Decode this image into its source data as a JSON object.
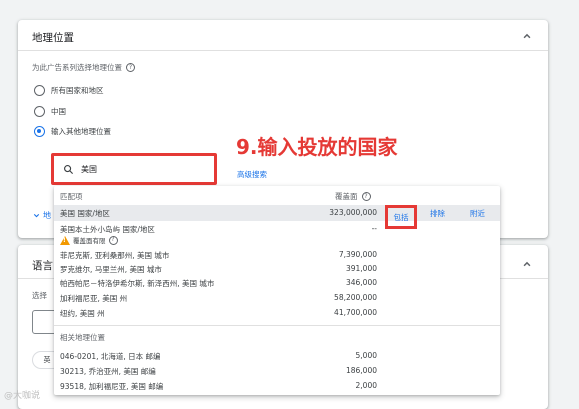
{
  "geo_card": {
    "title": "地理位置",
    "prompt": "为此广告系列选择地理位置",
    "options": [
      {
        "label": "所有国家和地区",
        "selected": false
      },
      {
        "label": "中国",
        "selected": false
      },
      {
        "label": "输入其他地理位置",
        "selected": true
      }
    ],
    "search_value": "美国",
    "advanced_search": "高级搜索",
    "expand_partial": "地"
  },
  "annotation": "9.输入投放的国家",
  "dropdown": {
    "col_match": "匹配项",
    "col_reach": "覆盖面",
    "rows": [
      {
        "name": "美国 国家/地区",
        "reach": "323,000,000",
        "highlight": true
      },
      {
        "name": "美国本土外小岛屿 国家/地区",
        "reach": "--",
        "warning": "覆盖面有限"
      },
      {
        "name": "菲尼克斯, 亚利桑那州, 美国 城市",
        "reach": "7,390,000"
      },
      {
        "name": "罗克维尔, 马里兰州, 美国 城市",
        "reach": "391,000"
      },
      {
        "name": "帕西帕尼－特洛伊希尔斯, 新泽西州, 美国 城市",
        "reach": "346,000"
      },
      {
        "name": "加利福尼亚, 美国 州",
        "reach": "58,200,000"
      },
      {
        "name": "纽约, 美国 州",
        "reach": "41,700,000"
      }
    ],
    "actions": {
      "include": "包括",
      "exclude": "排除",
      "near": "附近"
    },
    "related_title": "相关地理位置",
    "related": [
      {
        "name": "046-0201, 北海道, 日本 邮编",
        "reach": "5,000"
      },
      {
        "name": "30213, 乔治亚州, 美国 邮编",
        "reach": "186,000"
      },
      {
        "name": "93518, 加利福尼亚, 美国 邮编",
        "reach": "2,000"
      }
    ]
  },
  "lang_card": {
    "title_partial": "语言",
    "sub_partial": "选择",
    "chip_partial": "英"
  },
  "watermark": "@大咖说",
  "colors": {
    "accent": "#1a73e8",
    "annotation": "#e53935",
    "warning": "#f29900"
  }
}
